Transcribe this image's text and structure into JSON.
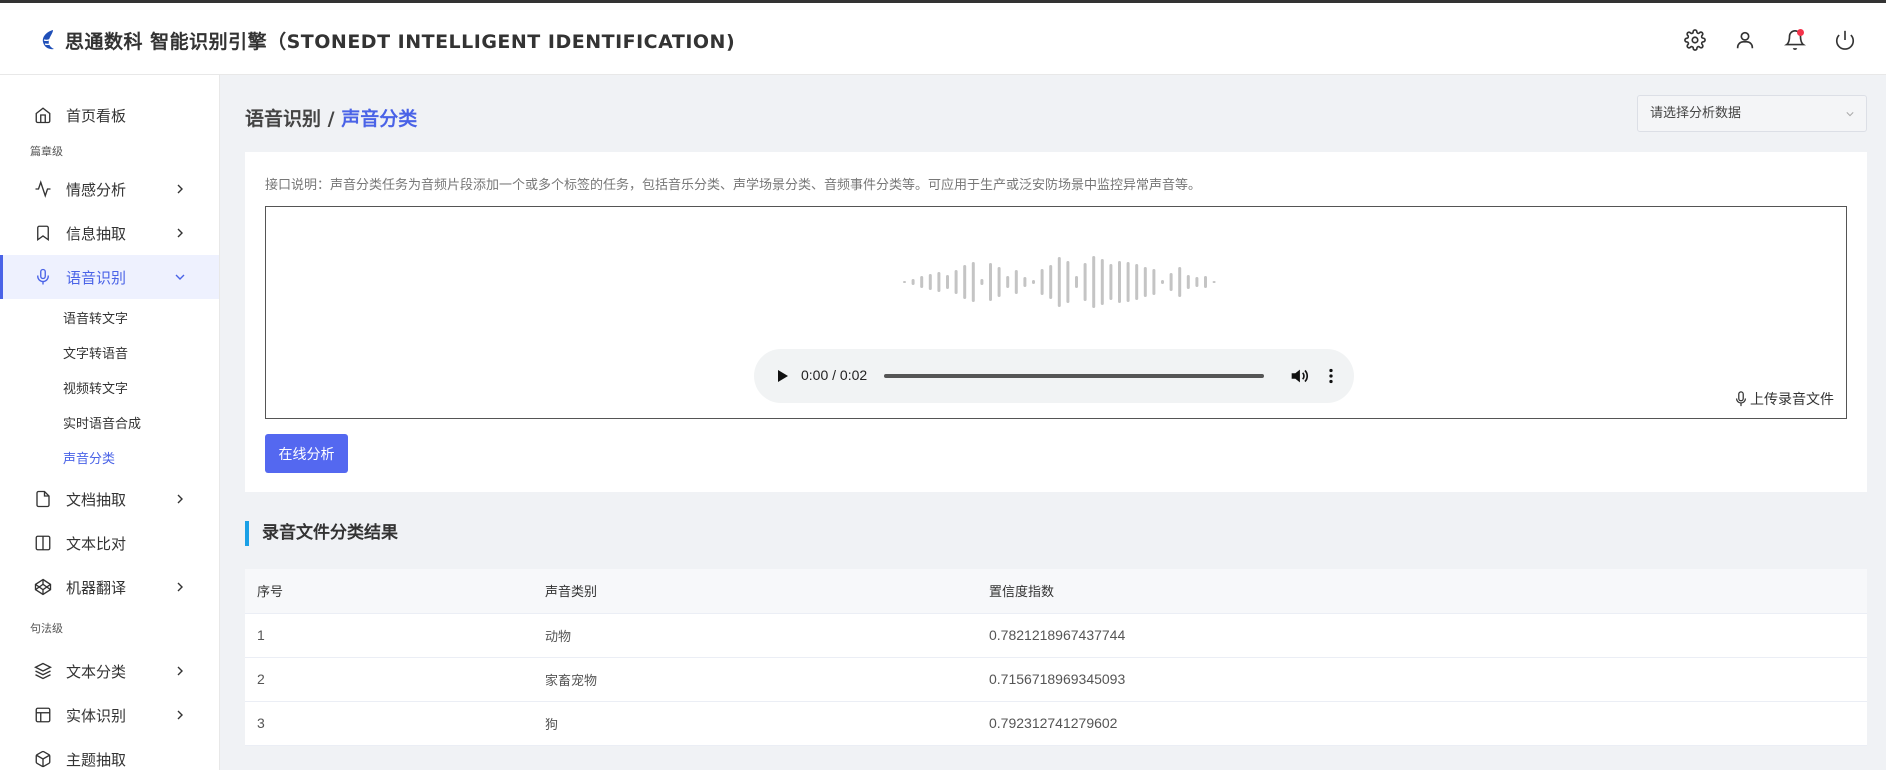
{
  "header": {
    "title": "思通数科 智能识别引擎（STONEDT INTELLIGENT IDENTIFICATION)",
    "icons": [
      "gear-icon",
      "user-icon",
      "bell-icon",
      "power-icon"
    ],
    "notification_dot_color": "#f5334b"
  },
  "sidebar": {
    "home": "首页看板",
    "section_chapter": "篇章级",
    "sentiment": "情感分析",
    "info_extract": "信息抽取",
    "speech": "语音识别",
    "speech_sub": [
      "语音转文字",
      "文字转语音",
      "视频转文字",
      "实时语音合成",
      "声音分类"
    ],
    "doc_extract": "文档抽取",
    "text_compare": "文本比对",
    "translate": "机器翻译",
    "section_sentence": "句法级",
    "text_classify": "文本分类",
    "entity": "实体识别",
    "topic": "主题抽取"
  },
  "breadcrumb": {
    "parent": "语音识别 /",
    "current": "声音分类"
  },
  "select": {
    "placeholder": "请选择分析数据"
  },
  "main": {
    "description": "接口说明：声音分类任务为音频片段添加一个或多个标签的任务，包括音乐分类、声学场景分类、音频事件分类等。可应用于生产或泛安防场景中监控异常声音等。",
    "player": {
      "time": "0:00 / 0:02",
      "progress": 0
    },
    "upload_label": "上传录音文件",
    "analyze_button": "在线分析"
  },
  "results": {
    "title": "录音文件分类结果",
    "columns": [
      "序号",
      "声音类别",
      "置信度指数"
    ],
    "rows": [
      [
        "1",
        "动物",
        "0.7821218967437744"
      ],
      [
        "2",
        "家畜宠物",
        "0.7156718969345093"
      ],
      [
        "3",
        "狗",
        "0.792312741279602"
      ]
    ]
  },
  "colors": {
    "accent": "#4a63e7",
    "button": "#5468f0",
    "title_bar": "#1aa0e6"
  }
}
